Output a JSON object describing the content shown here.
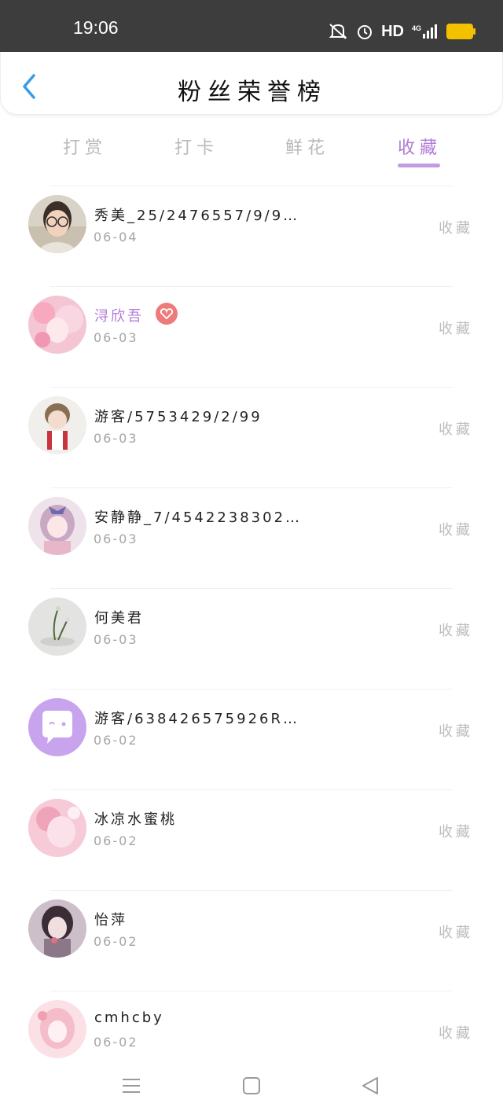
{
  "status_bar": {
    "time": "19:06",
    "network": "HD",
    "signal": "4G"
  },
  "header": {
    "title": "粉丝荣誉榜"
  },
  "tabs": [
    {
      "label": "打赏",
      "active": false
    },
    {
      "label": "打卡",
      "active": false
    },
    {
      "label": "鲜花",
      "active": false
    },
    {
      "label": "收藏",
      "active": true
    }
  ],
  "list": [
    {
      "name": "秀美_25/2476557/9/9…",
      "date": "06-04",
      "action": "收藏",
      "avatar": "photo-glasses-girl"
    },
    {
      "name": "浔欣吾",
      "date": "06-03",
      "action": "收藏",
      "avatar": "pink-anime",
      "highlight": true,
      "badge": "heart-badge"
    },
    {
      "name": "游客/5753429/2/99",
      "date": "06-03",
      "action": "收藏",
      "avatar": "chibi-character"
    },
    {
      "name": "安静静_7/4542238302…",
      "date": "06-03",
      "action": "收藏",
      "avatar": "anime-girl-bow"
    },
    {
      "name": "何美君",
      "date": "06-03",
      "action": "收藏",
      "avatar": "flower-arrangement"
    },
    {
      "name": "游客/638426575926R…",
      "date": "06-02",
      "action": "收藏",
      "avatar": "default-chat-bubble"
    },
    {
      "name": "冰凉水蜜桃",
      "date": "06-02",
      "action": "收藏",
      "avatar": "pink-anime-2"
    },
    {
      "name": "怡萍",
      "date": "06-02",
      "action": "收藏",
      "avatar": "dark-anime"
    },
    {
      "name": "cmhcby",
      "date": "06-02",
      "action": "收藏",
      "avatar": "pink-anime-3"
    }
  ],
  "colors": {
    "accent": "#b07bd5",
    "back": "#3a9be6",
    "status_bg": "#3d3d3d"
  }
}
